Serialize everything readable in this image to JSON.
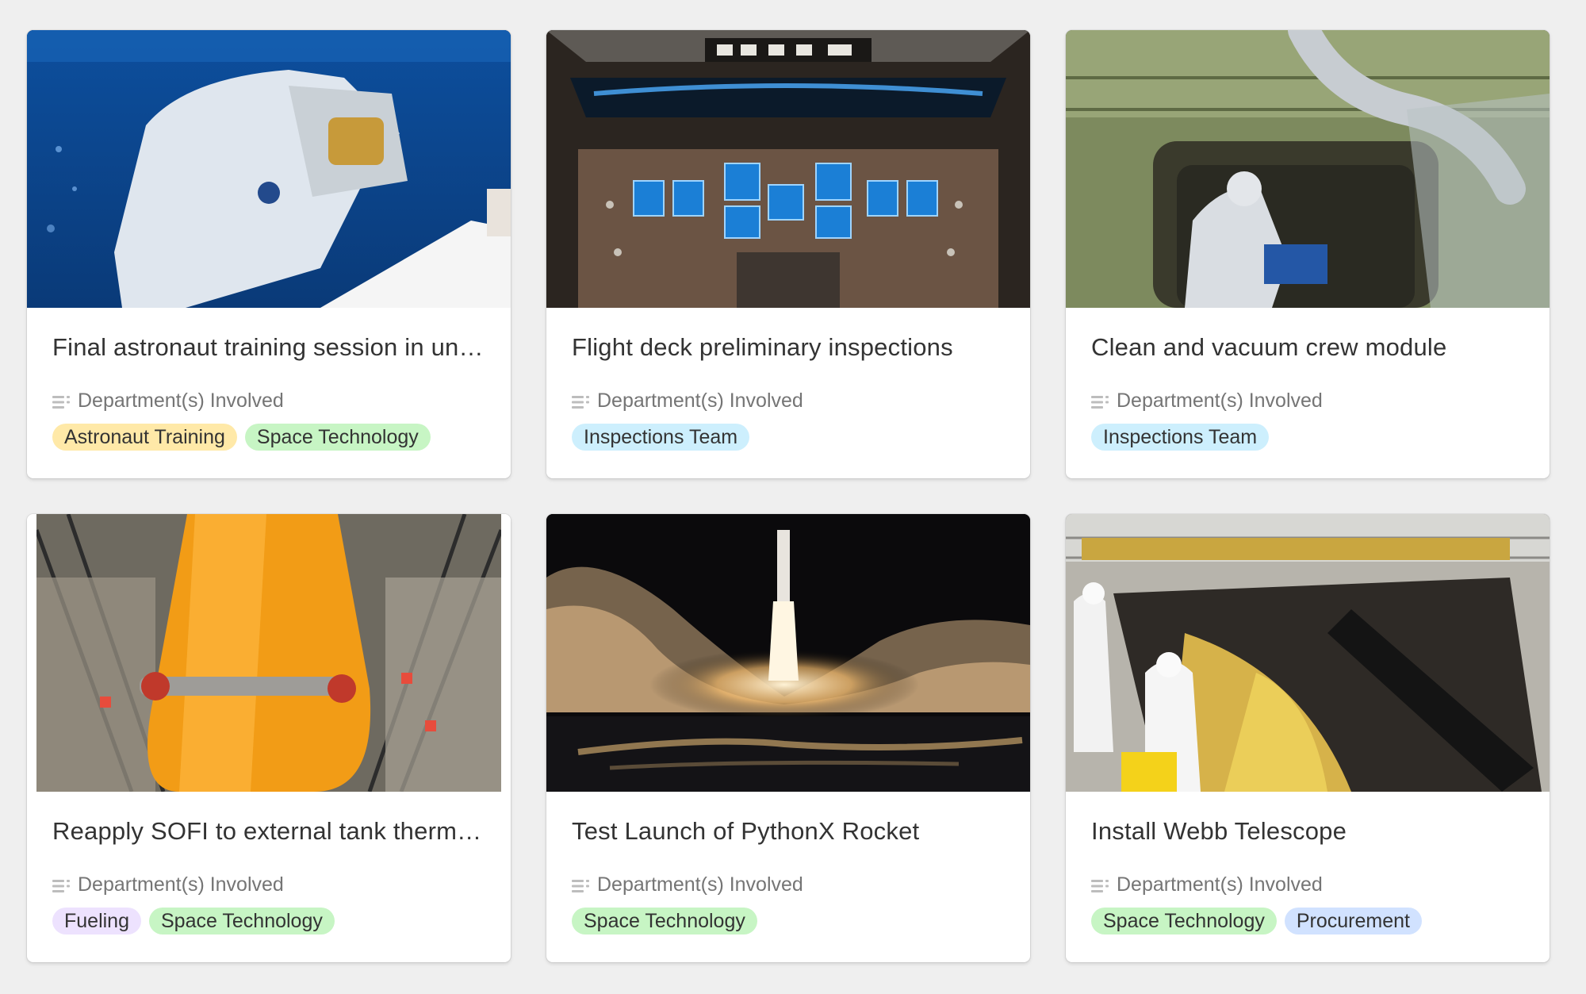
{
  "field_label": "Department(s) Involved",
  "tag_colors": {
    "Astronaut Training": "#ffe9a8",
    "Space Technology": "#c7f5c4",
    "Inspections Team": "#cdeffd",
    "Fueling": "#ede2fe",
    "Procurement": "#d1e2ff"
  },
  "cards": [
    {
      "title": "Final astronaut training session in underwater lab",
      "image": "astronaut-underwater",
      "tags": [
        "Astronaut Training",
        "Space Technology"
      ]
    },
    {
      "title": "Flight deck preliminary inspections",
      "image": "flight-deck-cockpit",
      "tags": [
        "Inspections Team"
      ]
    },
    {
      "title": "Clean and vacuum crew module",
      "image": "crew-module-interior",
      "tags": [
        "Inspections Team"
      ]
    },
    {
      "title": "Reapply SOFI to external tank thermal protection",
      "image": "external-tank",
      "tags": [
        "Fueling",
        "Space Technology"
      ]
    },
    {
      "title": "Test Launch of PythonX Rocket",
      "image": "night-rocket-launch",
      "tags": [
        "Space Technology"
      ]
    },
    {
      "title": "Install Webb Telescope",
      "image": "webb-telescope-cleanroom",
      "tags": [
        "Space Technology",
        "Procurement"
      ]
    }
  ]
}
